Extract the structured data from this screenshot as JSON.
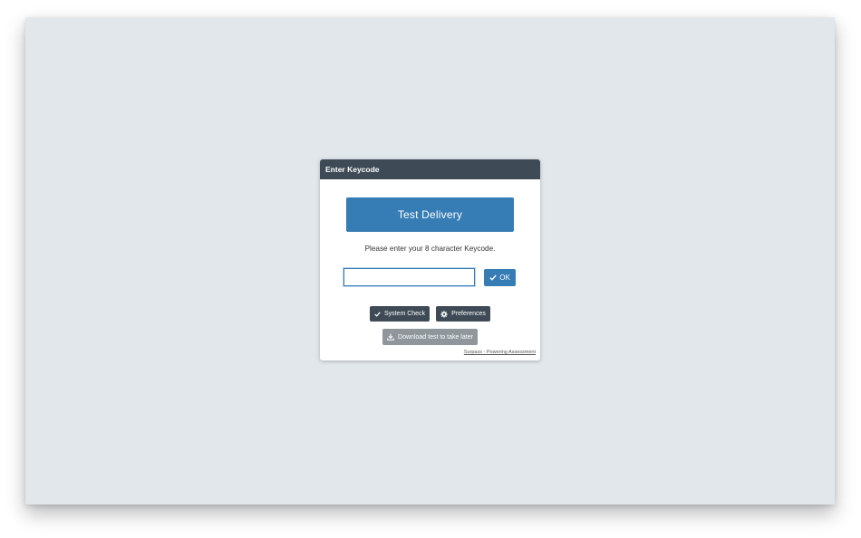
{
  "dialog": {
    "title": "Enter Keycode",
    "banner": "Test Delivery",
    "prompt": "Please enter your 8 character Keycode.",
    "keycode_input": {
      "value": "",
      "placeholder": ""
    },
    "ok_button": {
      "label": "OK",
      "icon": "check-icon"
    },
    "system_check_button": {
      "label": "System Check",
      "icon": "check-icon"
    },
    "preferences_button": {
      "label": "Preferences",
      "icon": "gear-icon"
    },
    "download_button": {
      "label": "Download test to take later",
      "icon": "download-icon"
    },
    "footer_link": "Surpass - Powering Assessment"
  },
  "colors": {
    "header": "#3e4a55",
    "accent": "#367cb5",
    "background": "#e1e7eb",
    "disabled": "#8f969c"
  }
}
